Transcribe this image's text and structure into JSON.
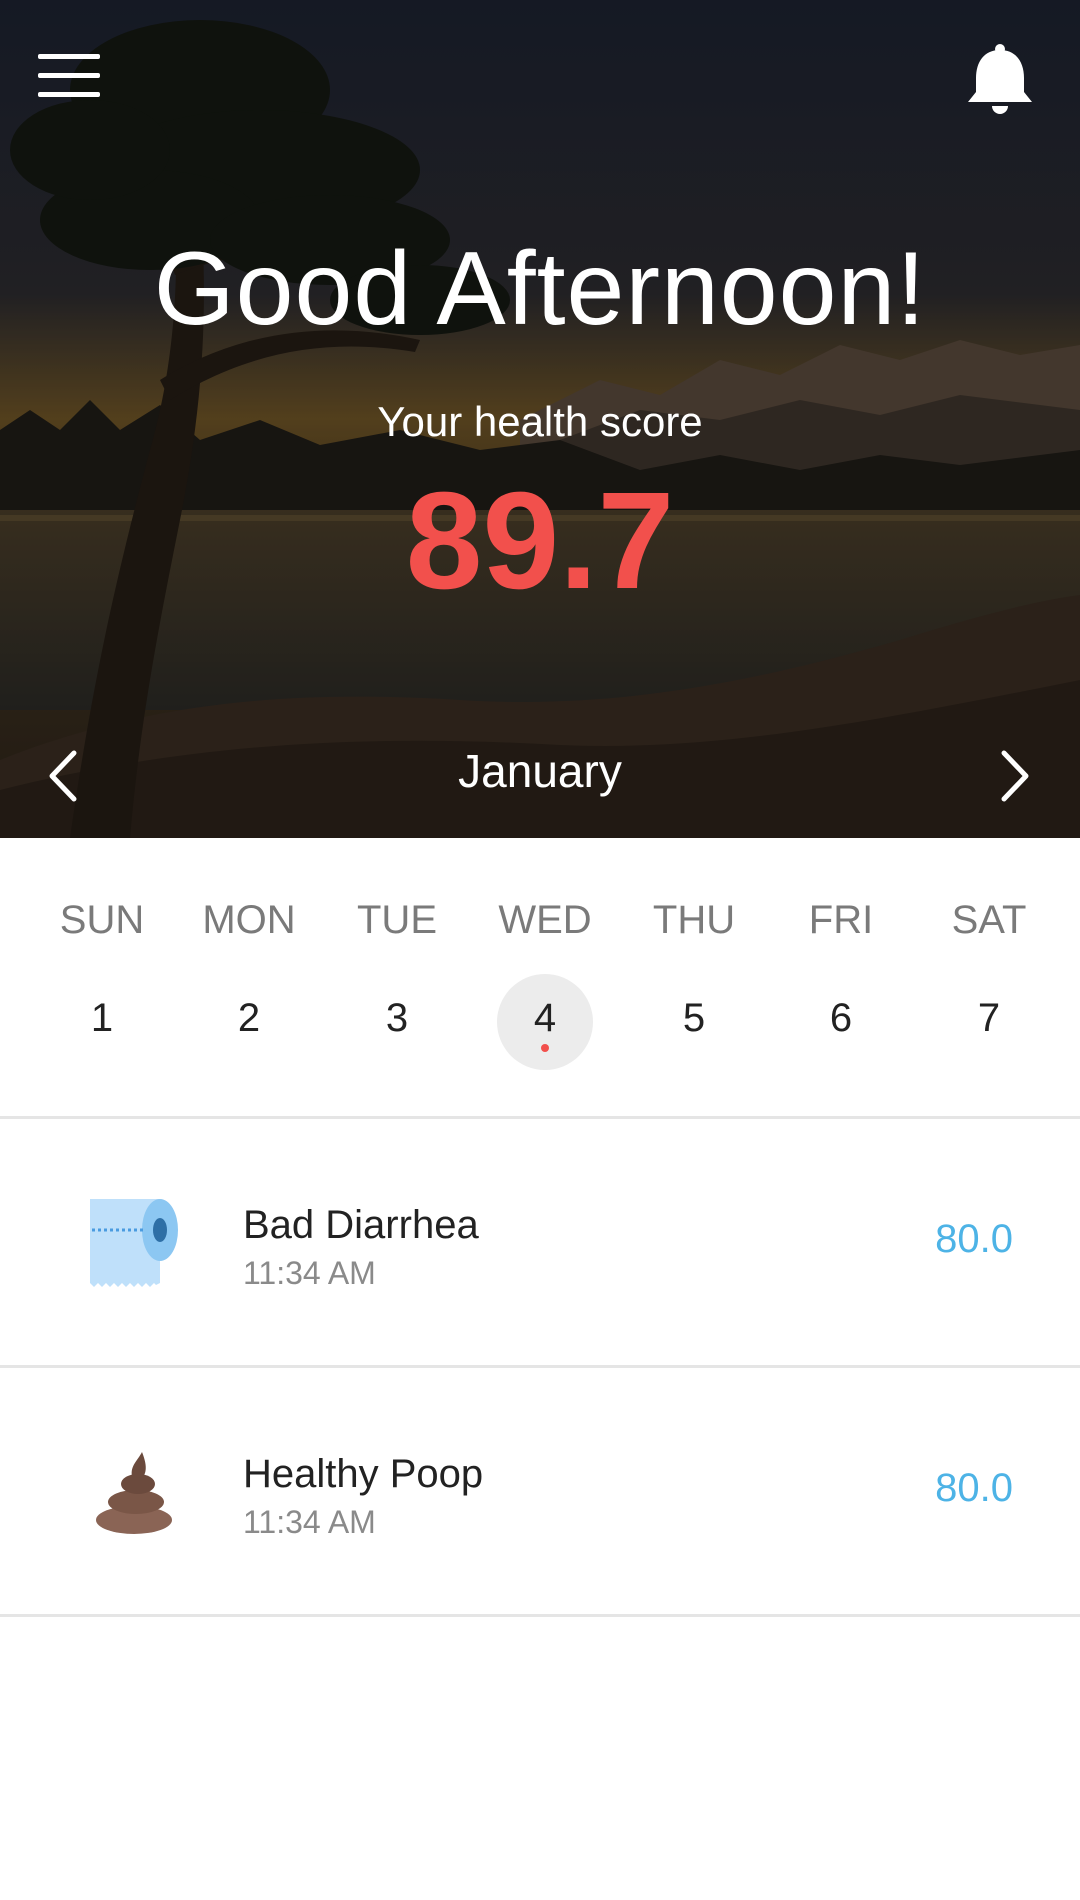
{
  "header": {
    "menu_icon": "hamburger-menu-icon",
    "notification_icon": "bell-icon",
    "greeting": "Good Afternoon!",
    "score_label": "Your health score",
    "score_value": "89.7",
    "score_color": "#f2504c"
  },
  "month_nav": {
    "month": "January",
    "prev_icon": "chevron-left-icon",
    "next_icon": "chevron-right-icon"
  },
  "calendar": {
    "weekdays": [
      "SUN",
      "MON",
      "TUE",
      "WED",
      "THU",
      "FRI",
      "SAT"
    ],
    "days": [
      "1",
      "2",
      "3",
      "4",
      "5",
      "6",
      "7"
    ],
    "selected_day": "4"
  },
  "entries": [
    {
      "title": "Bad Diarrhea",
      "time": "11:34 AM",
      "value": "80.0",
      "icon": "toilet-paper-icon"
    },
    {
      "title": "Healthy Poop",
      "time": "11:34 AM",
      "value": "80.0",
      "icon": "poop-icon"
    }
  ],
  "colors": {
    "accent_red": "#f2504c",
    "value_blue": "#4db3e6",
    "selected_day_bg": "#ececec"
  }
}
